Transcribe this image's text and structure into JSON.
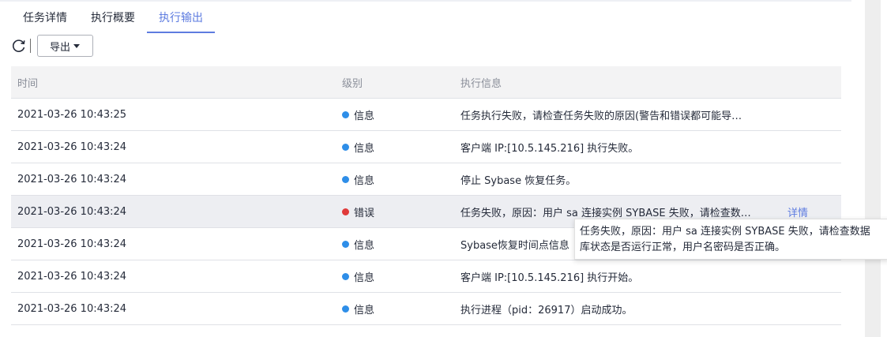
{
  "tabs": [
    {
      "label": "任务详情"
    },
    {
      "label": "执行概要"
    },
    {
      "label": "执行输出"
    }
  ],
  "toolbar": {
    "refresh_icon": "refresh-icon",
    "export_label": "导出"
  },
  "table": {
    "headers": {
      "time": "时间",
      "level": "级别",
      "message": "执行信息"
    },
    "rows": [
      {
        "time": "2021-03-26 10:43:25",
        "level": "信息",
        "level_type": "info",
        "message": "任务执行失败，请检查任务失败的原因(警告和错误都可能导…"
      },
      {
        "time": "2021-03-26 10:43:24",
        "level": "信息",
        "level_type": "info",
        "message": "客户端 IP:[10.5.145.216] 执行失败。"
      },
      {
        "time": "2021-03-26 10:43:24",
        "level": "信息",
        "level_type": "info",
        "message": "停止 Sybase 恢复任务。"
      },
      {
        "time": "2021-03-26 10:43:24",
        "level": "错误",
        "level_type": "error",
        "message": "任务失败，原因：用户 sa 连接实例 SYBASE 失败，请检查数…",
        "detail": "详情"
      },
      {
        "time": "2021-03-26 10:43:24",
        "level": "信息",
        "level_type": "info",
        "message": "Sybase恢复时间点信息"
      },
      {
        "time": "2021-03-26 10:43:24",
        "level": "信息",
        "level_type": "info",
        "message": "客户端 IP:[10.5.145.216] 执行开始。"
      },
      {
        "time": "2021-03-26 10:43:24",
        "level": "信息",
        "level_type": "info",
        "message": "执行进程（pid：26917）启动成功。"
      }
    ]
  },
  "tooltip": {
    "line1": "任务失败，原因：用户 sa 连接实例 SYBASE 失败，请检查数据",
    "line2": "库状态是否运行正常，用户名密码是否正确。"
  },
  "colors": {
    "accent": "#5e7ce0",
    "info": "#2e8ee8",
    "error": "#e03a3a"
  }
}
